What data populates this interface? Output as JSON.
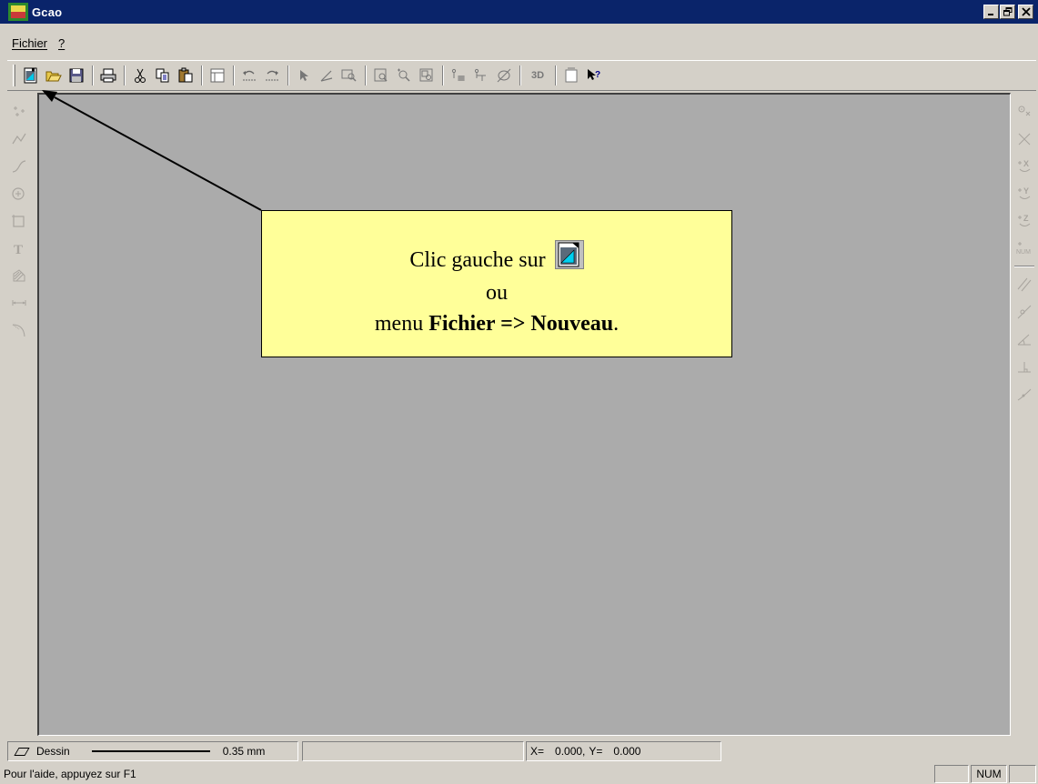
{
  "window": {
    "title": "Gcao",
    "controls": {
      "minimize": "_",
      "restore": "🗗",
      "close": "✕"
    }
  },
  "menu": {
    "items": [
      {
        "label": "Fichier",
        "accel": "F"
      },
      {
        "label": "?",
        "accel": "?"
      }
    ]
  },
  "toolbar": {
    "buttons": [
      "new-icon",
      "open-icon",
      "save-icon",
      "print-icon",
      "cut-icon",
      "copy-icon",
      "paste-icon",
      "properties-icon",
      "undo-icon",
      "redo-icon",
      "select-icon",
      "trim-icon",
      "zoom-window-icon",
      "zoom-all-icon",
      "zoom-realtime-icon",
      "zoom-extents-icon",
      "grid-icon",
      "snap-icon",
      "hide-icon",
      "3d-icon",
      "print-preview-icon",
      "context-help-icon"
    ],
    "label_3d": "3D"
  },
  "callout": {
    "line1": "Clic gauche sur",
    "line2": "ou",
    "line3_prefix": "menu ",
    "line3_bold": "Fichier => Nouveau",
    "line3_suffix": "."
  },
  "status": {
    "layer": "Dessin",
    "line_weight": "0.35 mm",
    "x_label": "X=",
    "x_value": "0.000,",
    "y_label": "Y=",
    "y_value": "0.000",
    "help": "Pour l'aide, appuyez sur F1",
    "num": "NUM"
  },
  "right_labels": {
    "x": "X",
    "y": "Y",
    "z": "Z",
    "num": "NUM"
  },
  "colors": {
    "titlebar": "#0a246a",
    "workspace": "#ababab",
    "callout_bg": "#ffff99",
    "chrome": "#d4d0c8"
  }
}
